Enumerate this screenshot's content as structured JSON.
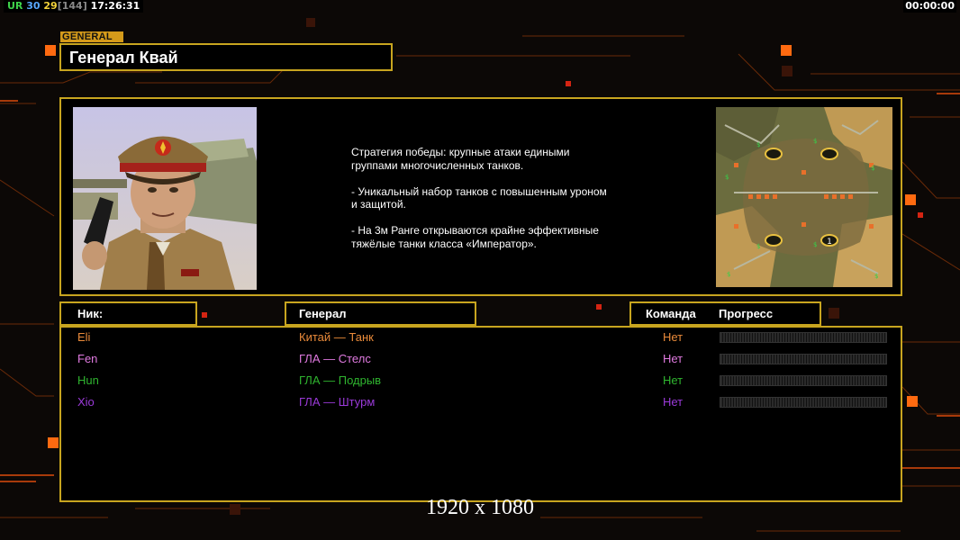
{
  "topbar": {
    "ur": "UR",
    "n1": "30",
    "n2": "29",
    "n3": "[144]",
    "clock": "17:26:31",
    "timer": "00:00:00"
  },
  "header": {
    "tag": "GENERAL",
    "title": "Генерал Квай"
  },
  "description": "Стратегия победы: крупные атаки едиными\n группами многочисленных танков.\n\n- Уникальный набор танков с повышенным уроном\n и защитой.\n\n- На 3м Ранге открываются крайне эффективные\n тяжёлые танки класса «Император».",
  "columns": {
    "nick": "Ник:",
    "general": "Генерал",
    "team": "Команда",
    "progress": "Прогресс"
  },
  "players": [
    {
      "nick": "Eli",
      "general": "Китай — Танк",
      "team": "Нет",
      "progress": 0,
      "color": "#e98a3a"
    },
    {
      "nick": "Fen",
      "general": "ГЛА — Стелс",
      "team": "Нет",
      "progress": 0,
      "color": "#e07ae0"
    },
    {
      "nick": "Hun",
      "general": "ГЛА — Подрыв",
      "team": "Нет",
      "progress": 0,
      "color": "#2fb52f"
    },
    {
      "nick": "Xio",
      "general": "ГЛА — Штурм",
      "team": "Нет",
      "progress": 0,
      "color": "#9a3ad8"
    }
  ],
  "caption": "1920 x 1080",
  "colors": {
    "accent": "#c8a51f",
    "orange": "#ff6a00",
    "red": "#d92a12"
  },
  "icons": [
    "portrait-image",
    "minimap-image"
  ]
}
